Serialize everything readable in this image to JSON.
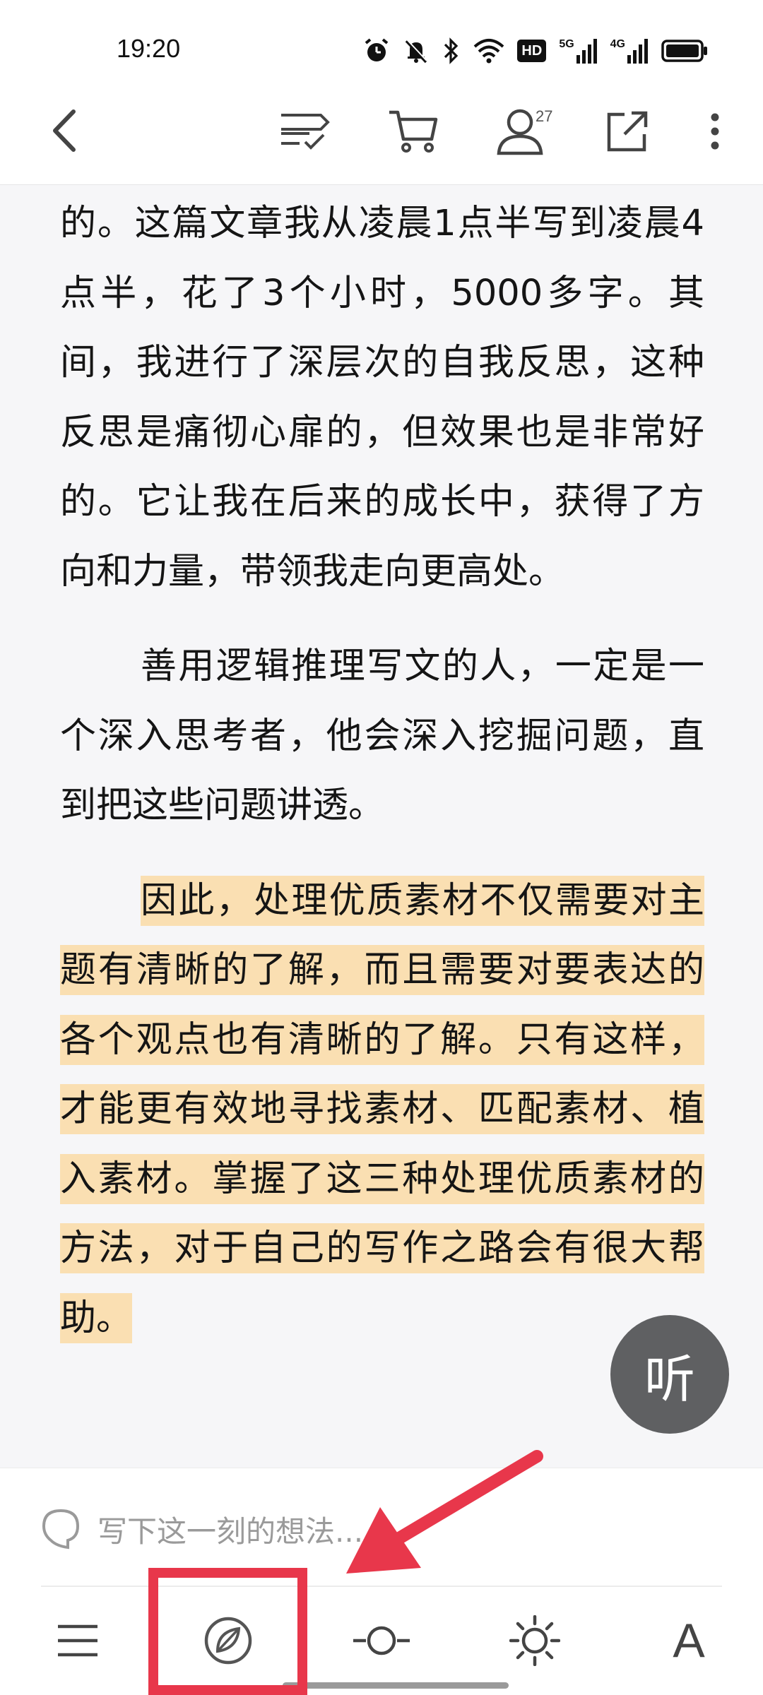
{
  "status_bar": {
    "time": "19:20",
    "icons": [
      "alarm-icon",
      "mute-icon",
      "bluetooth-icon",
      "wifi-icon",
      "hd-icon",
      "signal-5g-icon",
      "signal-4g-icon",
      "battery-icon"
    ],
    "hd_label": "HD",
    "net1_label": "5G",
    "net2_label": "4G"
  },
  "toolbar": {
    "follow_count": "27",
    "icons": [
      "back-icon",
      "tag-list-icon",
      "cart-icon",
      "user-icon",
      "share-icon",
      "more-icon"
    ]
  },
  "article": {
    "p1": "的。这篇文章我从凌晨1点半写到凌晨4点半，花了3个小时，5000多字。其间，我进行了深层次的自我反思，这种反思是痛彻心扉的，但效果也是非常好的。它让我在后来的成长中，获得了方向和力量，带领我走向更高处。",
    "p2": "善用逻辑推理写文的人，一定是一个深入思考者，他会深入挖掘问题，直到把这些问题讲透。",
    "p3": "因此，处理优质素材不仅需要对主题有清晰的了解，而且需要对要表达的各个观点也有清晰的了解。只有这样，才能更有效地寻找素材、匹配素材、植入素材。掌握了这三种处理优质素材的方法，对于自己的写作之路会有很大帮助。"
  },
  "listen_button": {
    "label": "听"
  },
  "note_input": {
    "placeholder": "写下这一刻的想法..."
  },
  "bottom_nav": {
    "font_label": "A",
    "icons": [
      "menu-icon",
      "compass-icon",
      "progress-icon",
      "brightness-icon",
      "font-icon"
    ]
  },
  "colors": {
    "highlight": "#fadfb2",
    "annotation": "#e8374b",
    "listen_bg": "#5f6062"
  }
}
